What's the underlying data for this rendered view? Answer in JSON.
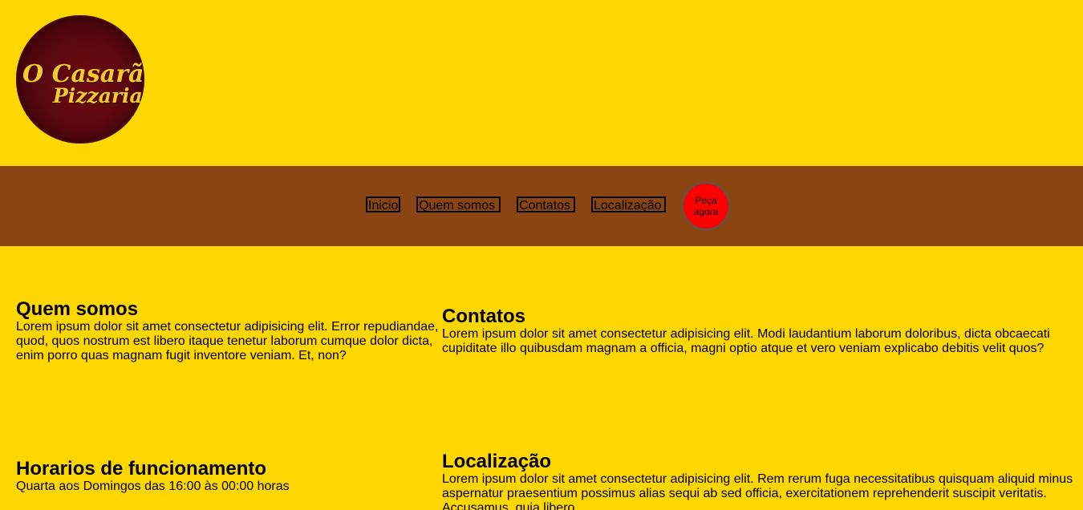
{
  "logo": {
    "line1": "O Casarão",
    "line2": "Pizzaria"
  },
  "nav": {
    "items": [
      {
        "label": "Inicio"
      },
      {
        "label": "Quem somos"
      },
      {
        "label": "Contatos"
      },
      {
        "label": "Localização"
      }
    ],
    "order_button": "Peça agora"
  },
  "sections": {
    "quem_somos": {
      "title": "Quem somos",
      "text": "Lorem ipsum dolor sit amet consectetur adipisicing elit. Error repudiandae, quod, quos nostrum est libero itaque tenetur laborum cumque dolor dicta, enim porro quas magnam fugit inventore veniam. Et, non?"
    },
    "contatos": {
      "title": "Contatos",
      "text": "Lorem ipsum dolor sit amet consectetur adipisicing elit. Modi laudantium laborum doloribus, dicta obcaecati cupiditate illo quibusdam magnam a officia, magni optio atque et vero veniam explicabo debitis velit quos?"
    },
    "horarios": {
      "title": "Horarios de funcionamento",
      "text": "Quarta aos Domingos das 16:00 às 00:00 horas"
    },
    "localizacao": {
      "title": "Localização",
      "text": "Lorem ipsum dolor sit amet consectetur adipisicing elit. Rem rerum fuga necessitatibus quisquam aliquid minus aspernatur praesentium possimus alias sequi ab sed officia, exercitationem reprehenderit suscipit veritatis. Accusamus, quia libero."
    }
  },
  "colors": {
    "page_background": "#FFD700",
    "nav_background": "#8B4513",
    "order_button": "#FF0000",
    "logo_background": "#5a0810",
    "logo_text": "#F6CC2A"
  }
}
